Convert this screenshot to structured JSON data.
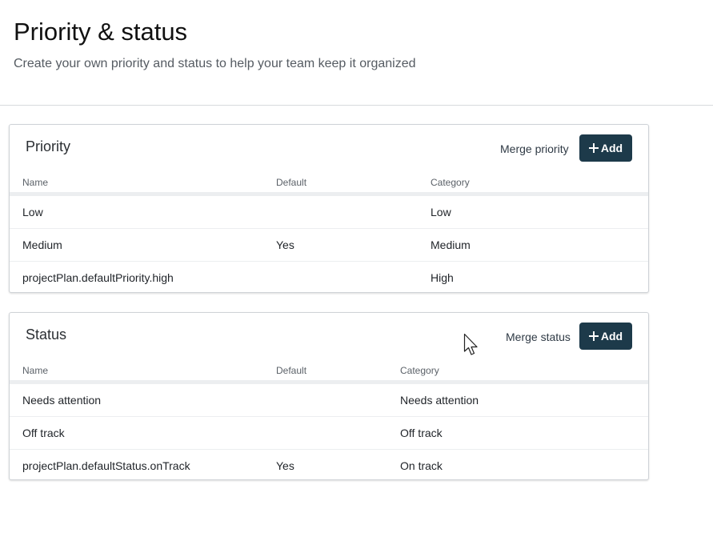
{
  "header": {
    "title": "Priority & status",
    "subtitle": "Create your own priority and status to help your team keep it organized"
  },
  "priority": {
    "title": "Priority",
    "merge_label": "Merge priority",
    "add_label": "Add",
    "columns": [
      "Name",
      "Default",
      "Category"
    ],
    "rows": [
      {
        "name": "Low",
        "default": "",
        "category": "Low"
      },
      {
        "name": "Medium",
        "default": "Yes",
        "category": "Medium"
      },
      {
        "name": "projectPlan.defaultPriority.high",
        "default": "",
        "category": "High"
      }
    ]
  },
  "status": {
    "title": "Status",
    "merge_label": "Merge status",
    "add_label": "Add",
    "columns": [
      "Name",
      "Default",
      "Category"
    ],
    "rows": [
      {
        "name": "Needs attention",
        "default": "",
        "category": "Needs attention"
      },
      {
        "name": "Off track",
        "default": "",
        "category": "Off track"
      },
      {
        "name": "projectPlan.defaultStatus.onTrack",
        "default": "Yes",
        "category": "On track"
      }
    ]
  },
  "icons": {
    "add": "plus-icon",
    "cursor": "mouse-pointer-icon"
  },
  "colors": {
    "add_button_bg": "#1d3a4a",
    "divider": "#d8dadd"
  }
}
